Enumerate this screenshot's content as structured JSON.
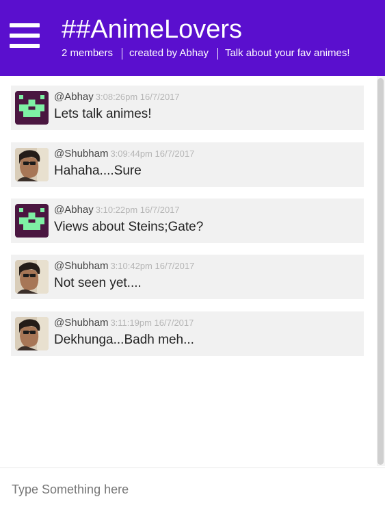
{
  "header": {
    "menu_icon": "hamburger-menu-icon",
    "title": "##AnimeLovers",
    "members": "2 members",
    "created_by": "created by Abhay",
    "description": "Talk about your fav animes!"
  },
  "colors": {
    "header_bg": "#5a0fce",
    "message_bg": "#f1f1f1",
    "timestamp": "#b5b5b5",
    "identicon_bg": "#4a1640",
    "identicon_fg": "#7ef0a4"
  },
  "messages": [
    {
      "avatar": "identicon-avatar",
      "username": "@Abhay",
      "timestamp": "3:08:26pm 16/7/2017",
      "text": "Lets talk animes!"
    },
    {
      "avatar": "photo-avatar",
      "username": "@Shubham",
      "timestamp": "3:09:44pm 16/7/2017",
      "text": "Hahaha....Sure"
    },
    {
      "avatar": "identicon-avatar",
      "username": "@Abhay",
      "timestamp": "3:10:22pm 16/7/2017",
      "text": "Views about Steins;Gate?"
    },
    {
      "avatar": "photo-avatar",
      "username": "@Shubham",
      "timestamp": "3:10:42pm 16/7/2017",
      "text": "Not seen yet...."
    },
    {
      "avatar": "photo-avatar",
      "username": "@Shubham",
      "timestamp": "3:11:19pm 16/7/2017",
      "text": "Dekhunga...Badh meh..."
    }
  ],
  "composer": {
    "placeholder": "Type Something here",
    "value": ""
  }
}
